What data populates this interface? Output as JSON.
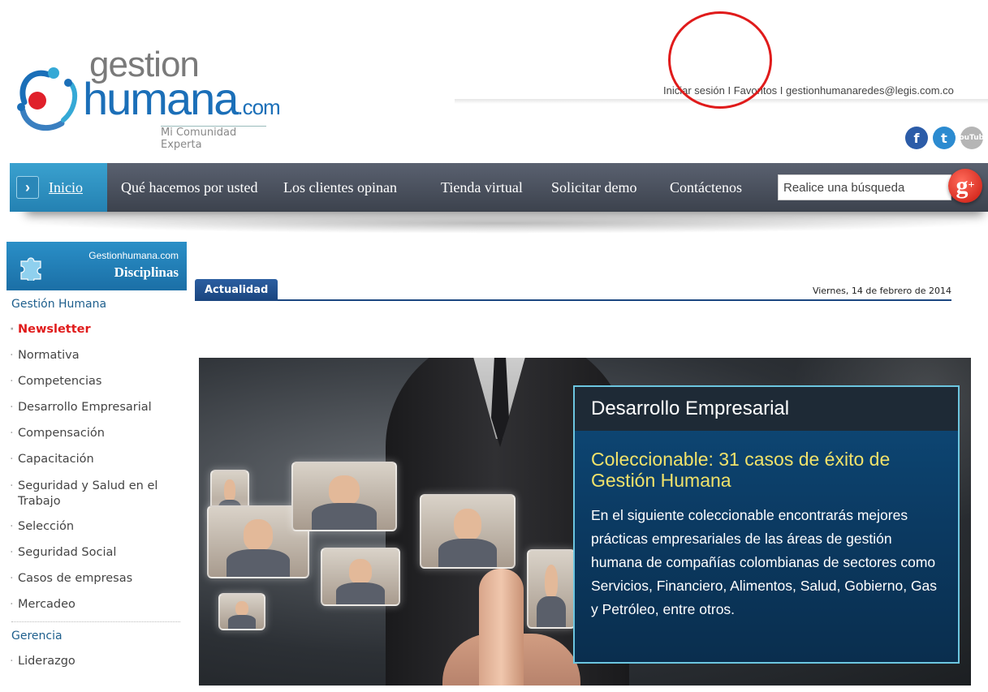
{
  "header": {
    "logo_word1": "gestion",
    "logo_word2": "humana",
    "logo_suffix": ".com",
    "tagline": "Mi Comunidad Experta",
    "links": {
      "login": "Iniciar sesión",
      "sep1": " I ",
      "favorites": "Favoritos",
      "sep2": " I ",
      "email": "gestionhumanaredes@legis.com.co"
    },
    "social": {
      "facebook": "f",
      "twitter": "t",
      "youtube_1": "You",
      "youtube_2": "Tube"
    }
  },
  "nav": {
    "home": "Inicio",
    "items": [
      "Qué hacemos por usted",
      "Los clientes opinan",
      "Tienda virtual",
      "Solicitar demo",
      "Contáctenos"
    ],
    "search_placeholder": "Realice una búsqueda",
    "gplus": "g",
    "gplus_sup": "+"
  },
  "sidebar": {
    "title_small": "Gestionhumana.com",
    "title_big": "Disciplinas",
    "section1": "Gestión Humana",
    "items1": [
      "Newsletter",
      "Normativa",
      "Competencias",
      "Desarrollo Empresarial",
      "Compensación",
      "Capacitación",
      "Seguridad y Salud en el Trabajo",
      "Selección",
      "Seguridad Social",
      "Casos de empresas",
      "Mercadeo"
    ],
    "section2": "Gerencia",
    "items2": [
      "Liderazgo"
    ]
  },
  "main": {
    "tab": "Actualidad",
    "date": "Viernes, 14 de febrero de 2014",
    "hero": {
      "category": "Desarrollo Empresarial",
      "title": "Coleccionable: 31 casos de éxito de Gestión Humana",
      "body": "En el siguiente coleccionable encontrarás mejores prácticas empresariales de las áreas de gestión humana de compañías colombianas de sectores como Servicios, Financiero, Alimentos, Salud, Gobierno, Gas y Petróleo, entre otros."
    }
  },
  "colors": {
    "brand_blue": "#1b6fb8",
    "nav_dark": "#3c424d",
    "accent_red": "#e01b1b",
    "hero_title_yellow": "#f1e26a"
  }
}
